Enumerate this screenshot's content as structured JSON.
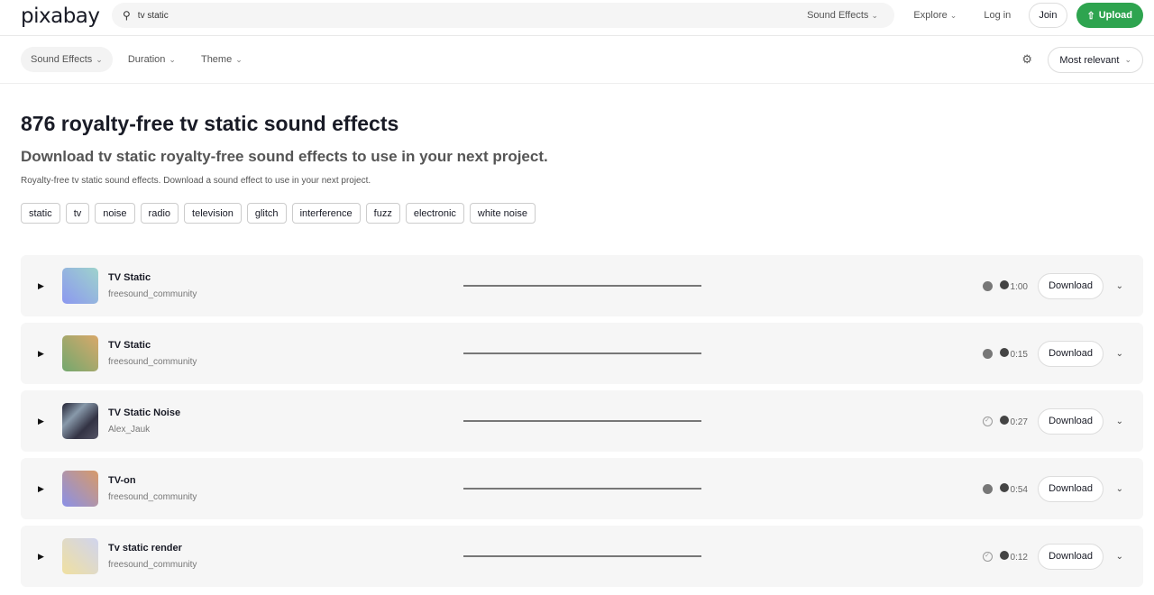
{
  "header": {
    "logo": "pixabay",
    "search_value": "tv static",
    "search_type": "Sound Effects",
    "explore": "Explore",
    "login": "Log in",
    "join": "Join",
    "upload": "Upload"
  },
  "filters": {
    "items": [
      "Sound Effects",
      "Duration",
      "Theme"
    ],
    "sort": "Most relevant"
  },
  "page": {
    "title": "876 royalty-free tv static sound effects",
    "subtitle": "Download tv static royalty-free sound effects to use in your next project.",
    "description": "Royalty-free tv static sound effects. Download a sound effect to use in your next project."
  },
  "tags": [
    "static",
    "tv",
    "noise",
    "radio",
    "television",
    "glitch",
    "interference",
    "fuzz",
    "electronic",
    "white noise"
  ],
  "tracks": [
    {
      "title": "TV Static",
      "author": "freesound_community",
      "duration": "1:00",
      "badge": "star",
      "download": "Download",
      "thumb": "linear-gradient(45deg,#8c98f0,#9ed3cc)"
    },
    {
      "title": "TV Static",
      "author": "freesound_community",
      "duration": "0:15",
      "badge": "star",
      "download": "Download",
      "thumb": "linear-gradient(45deg,#72a86e,#d9a86a)"
    },
    {
      "title": "TV Static Noise",
      "author": "Alex_Jauk",
      "duration": "0:27",
      "badge": "check",
      "download": "Download",
      "thumb": "linear-gradient(135deg,#223,#89a,#334,#556)"
    },
    {
      "title": "TV-on",
      "author": "freesound_community",
      "duration": "0:54",
      "badge": "star",
      "download": "Download",
      "thumb": "linear-gradient(45deg,#8a90e8,#d89a68)"
    },
    {
      "title": "Tv static render",
      "author": "freesound_community",
      "duration": "0:12",
      "badge": "check",
      "download": "Download",
      "thumb": "linear-gradient(45deg,#f0e0a0,#d0d4ee)"
    }
  ]
}
